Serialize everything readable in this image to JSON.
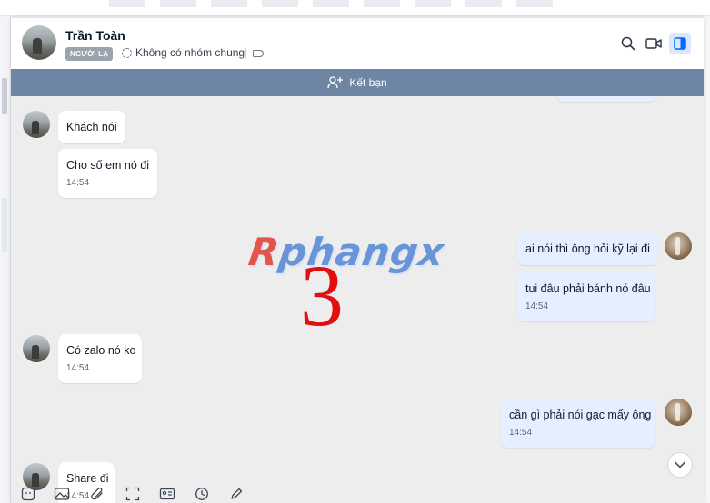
{
  "header": {
    "contact_name": "Trần Toàn",
    "stranger_label": "NGƯỜI LẠ",
    "group_status": "Không có nhóm chung"
  },
  "friend_bar": {
    "label": "Kết bạn"
  },
  "messages": [
    {
      "side": "in",
      "text": "Khách nói",
      "time": ""
    },
    {
      "side": "in",
      "text": "Cho số em nó đi",
      "time": "14:54"
    },
    {
      "side": "out",
      "text": "ai nói thì ông hỏi kỹ lại đi",
      "time": ""
    },
    {
      "side": "out",
      "text": "tui đâu phải bánh nó đâu",
      "time": "14:54"
    },
    {
      "side": "in",
      "text": "Có zalo nó ko",
      "time": "14:54"
    },
    {
      "side": "out",
      "text": "cần gì phải nói gạc mấy ông",
      "time": "14:54"
    },
    {
      "side": "in",
      "text": "Share đi",
      "time": "14:54"
    }
  ],
  "watermark": {
    "brand_r": "R",
    "brand_rest": "phangx",
    "number": "3"
  },
  "colors": {
    "friend_bar": "#6e85a3",
    "outgoing_bubble": "#e5efff",
    "incoming_bubble": "#ffffff",
    "chat_bg": "#ededed"
  },
  "icons": [
    "search-icon",
    "video-call-icon",
    "sidebar-panel-icon",
    "add-friend-icon",
    "chevron-down-icon",
    "sticker-icon",
    "image-icon",
    "attachment-icon",
    "screenshot-icon",
    "contact-card-icon",
    "clock-icon",
    "draw-icon"
  ]
}
